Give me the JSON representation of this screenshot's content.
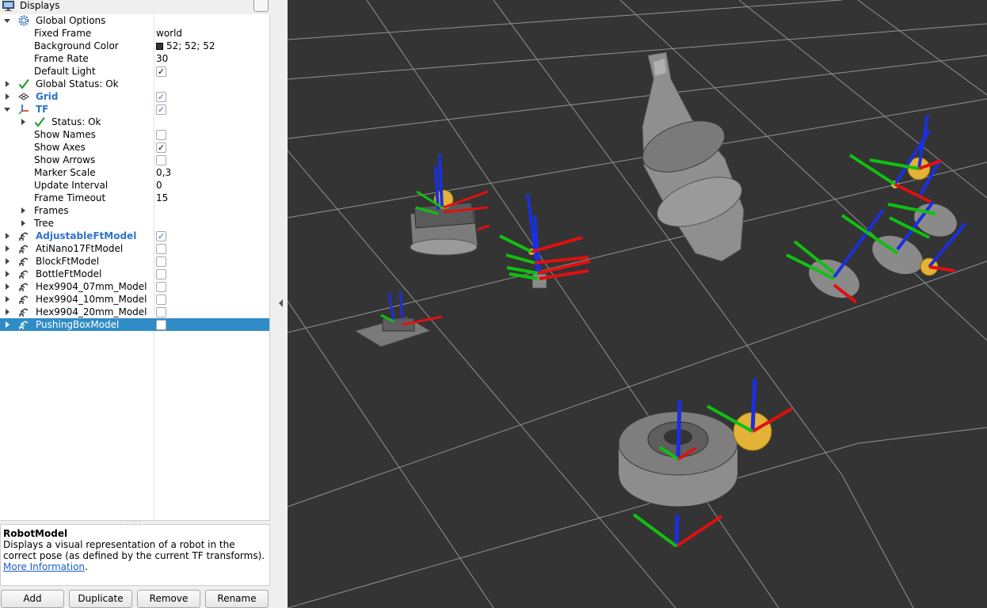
{
  "panel": {
    "title": "Displays"
  },
  "tree": {
    "global_options": {
      "label": "Global Options",
      "fixed_frame": {
        "label": "Fixed Frame",
        "value": "world"
      },
      "background_color": {
        "label": "Background Color",
        "value": "52; 52; 52"
      },
      "frame_rate": {
        "label": "Frame Rate",
        "value": "30"
      },
      "default_light": {
        "label": "Default Light",
        "checked": true
      }
    },
    "global_status": {
      "label": "Global Status: Ok"
    },
    "grid": {
      "label": "Grid",
      "checked": true
    },
    "tf": {
      "label": "TF",
      "checked": true,
      "status": {
        "label": "Status: Ok"
      },
      "show_names": {
        "label": "Show Names",
        "checked": false
      },
      "show_axes": {
        "label": "Show Axes",
        "checked": true
      },
      "show_arrows": {
        "label": "Show Arrows",
        "checked": false
      },
      "marker_scale": {
        "label": "Marker Scale",
        "value": "0,3"
      },
      "update_interval": {
        "label": "Update Interval",
        "value": "0"
      },
      "frame_timeout": {
        "label": "Frame Timeout",
        "value": "15"
      },
      "frames": {
        "label": "Frames"
      },
      "tree": {
        "label": "Tree"
      }
    },
    "robot_models": [
      {
        "label": "AdjustableFtModel",
        "checked": true
      },
      {
        "label": "AtiNano17FtModel",
        "checked": false
      },
      {
        "label": "BlockFtModel",
        "checked": false
      },
      {
        "label": "BottleFtModel",
        "checked": false
      },
      {
        "label": "Hex9904_07mm_Model",
        "checked": false
      },
      {
        "label": "Hex9904_10mm_Model",
        "checked": false
      },
      {
        "label": "Hex9904_20mm_Model",
        "checked": false
      },
      {
        "label": "PushingBoxModel",
        "checked": false,
        "selected": true
      }
    ]
  },
  "help": {
    "title": "RobotModel",
    "text": "Displays a visual representation of a robot in the correct pose (as defined by the current TF transforms).",
    "link": "More Information",
    "link_suffix": "."
  },
  "buttons": {
    "add": "Add",
    "duplicate": "Duplicate",
    "remove": "Remove",
    "rename": "Rename"
  },
  "colors": {
    "viewport_background": "#343434",
    "grid_line": "#a0a0a0",
    "selection": "#308cc6",
    "axis_x": "#e01010",
    "axis_y": "#10c010",
    "axis_z": "#1020e0",
    "frame_sphere": "#e8b830"
  }
}
